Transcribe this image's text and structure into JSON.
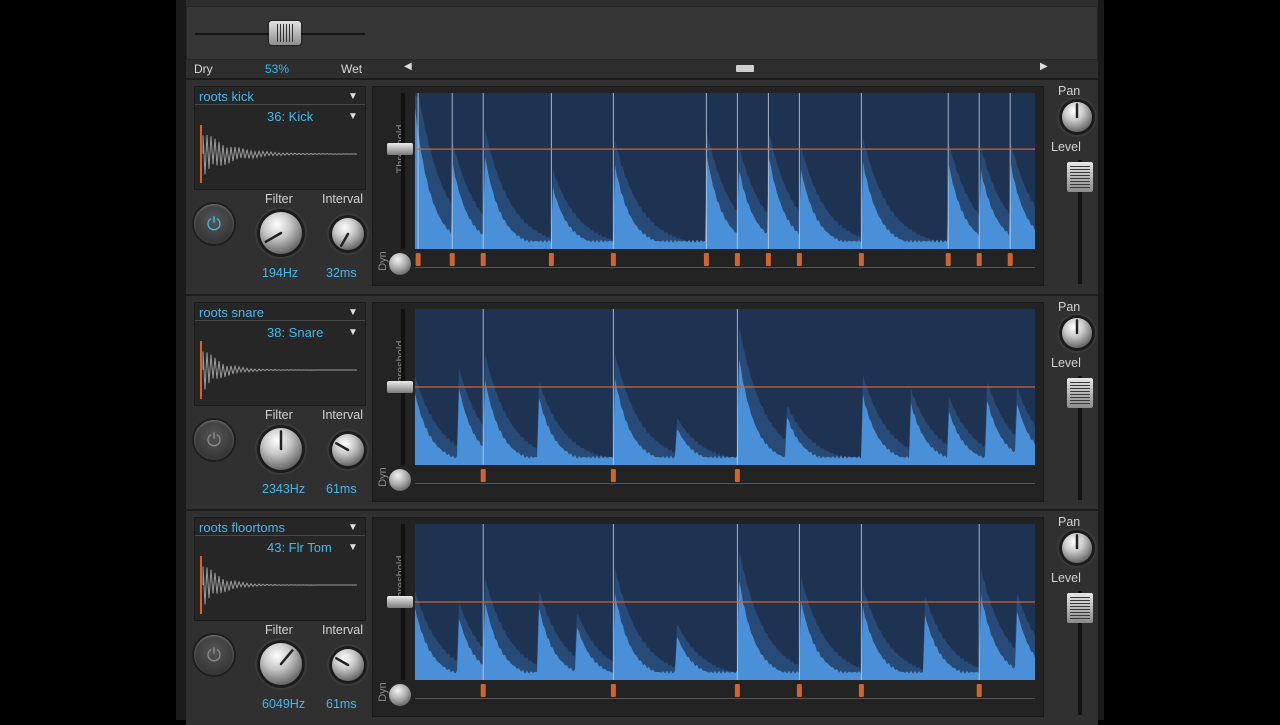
{
  "mix": {
    "dry_label": "Dry",
    "value": "53%",
    "wet_label": "Wet",
    "position": 0.53
  },
  "colors": {
    "accent": "#3fb6e8",
    "waveform": "#4a90d9",
    "waveform_dark": "#2b5487",
    "plot_bg": "#1e3352",
    "threshold_line": "#d2632a",
    "marker": "#d2632a"
  },
  "tracks": [
    {
      "instrument": "roots kick",
      "note": "36: Kick",
      "power_on": true,
      "filter_label": "Filter",
      "filter_value": "194Hz",
      "interval_label": "Interval",
      "interval_value": "32ms",
      "threshold_label": "Threshold",
      "dyn_label": "Dyn",
      "pan_label": "Pan",
      "level_label": "Level",
      "threshold_level": 0.64,
      "peaks": [
        0.0,
        0.06,
        0.11,
        0.22,
        0.32,
        0.47,
        0.52,
        0.57,
        0.62,
        0.72,
        0.86,
        0.91,
        0.96
      ],
      "peak_heights": [
        0.9,
        0.55,
        0.65,
        0.42,
        0.58,
        0.6,
        0.55,
        0.6,
        0.55,
        0.6,
        0.55,
        0.55,
        0.55
      ],
      "markers": [
        0.005,
        0.06,
        0.11,
        0.22,
        0.32,
        0.47,
        0.52,
        0.57,
        0.62,
        0.72,
        0.86,
        0.91,
        0.96
      ]
    },
    {
      "instrument": "roots snare",
      "note": "38: Snare",
      "power_on": false,
      "filter_label": "Filter",
      "filter_value": "2343Hz",
      "interval_label": "Interval",
      "interval_value": "61ms",
      "threshold_label": "Threshold",
      "dyn_label": "Dyn",
      "pan_label": "Pan",
      "level_label": "Level",
      "threshold_level": 0.5,
      "peaks": [
        0.0,
        0.07,
        0.11,
        0.2,
        0.32,
        0.42,
        0.52,
        0.6,
        0.72,
        0.8,
        0.86,
        0.92,
        0.97
      ],
      "peak_heights": [
        0.45,
        0.5,
        0.6,
        0.42,
        0.6,
        0.25,
        0.75,
        0.3,
        0.48,
        0.38,
        0.35,
        0.45,
        0.4
      ],
      "markers": [
        0.11,
        0.32,
        0.52
      ]
    },
    {
      "instrument": "roots floortoms",
      "note": "43: Flr Tom",
      "power_on": false,
      "filter_label": "Filter",
      "filter_value": "6049Hz",
      "interval_label": "Interval",
      "interval_value": "61ms",
      "threshold_label": "Threshold",
      "dyn_label": "Dyn",
      "pan_label": "Pan",
      "level_label": "Level",
      "threshold_level": 0.5,
      "peaks": [
        0.0,
        0.07,
        0.11,
        0.2,
        0.26,
        0.32,
        0.42,
        0.52,
        0.62,
        0.72,
        0.82,
        0.91,
        0.97
      ],
      "peak_heights": [
        0.45,
        0.4,
        0.55,
        0.45,
        0.35,
        0.6,
        0.3,
        0.7,
        0.55,
        0.5,
        0.45,
        0.6,
        0.45
      ],
      "markers": [
        0.11,
        0.32,
        0.52,
        0.62,
        0.72,
        0.91
      ]
    }
  ]
}
